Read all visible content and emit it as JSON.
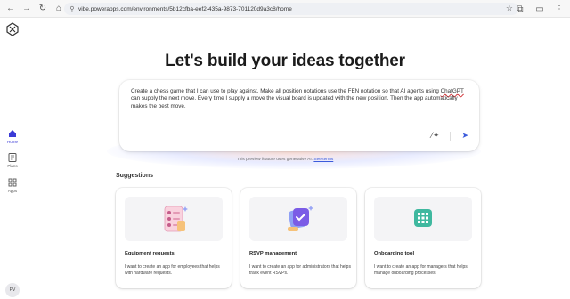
{
  "browser": {
    "url": "vibe.powerapps.com/environments/5b12cfba-eef2-435a-9873-701120d9a3c8/home",
    "nav": [
      "back-icon",
      "forward-icon",
      "refresh-icon",
      "home-icon"
    ]
  },
  "rail": {
    "items": [
      {
        "label": "Home",
        "icon": "home-icon",
        "active": true
      },
      {
        "label": "Plans",
        "icon": "plans-icon",
        "active": false
      },
      {
        "label": "Apps",
        "icon": "apps-icon",
        "active": false
      }
    ],
    "avatar": "PV"
  },
  "main": {
    "headline": "Let's build your ideas together",
    "prompt": {
      "text_before": "Create a chess game that I can use to play against. Make all position notations use the FEN notation so that AI agents using ",
      "text_spell": "ChatGPT",
      "text_after": " can supply the next move. Every time I supply a move the visual board is updated with the new position. Then the app automatically makes the best move."
    },
    "disclaimer": "This preview feature uses generative AI.",
    "disclaimer_link": "See terms",
    "suggestions_title": "Suggestions",
    "suggestions": [
      {
        "title": "Equipment requests",
        "desc": "I want to create an app for employees that helps with hardware requests."
      },
      {
        "title": "RSVP management",
        "desc": "I want to create an app for administrators that helps track event RSVPs."
      },
      {
        "title": "Onboarding tool",
        "desc": "I want to create an app for managers that helps manage onboarding processes."
      }
    ]
  },
  "colors": {
    "accent": "#3b5bdb",
    "active_nav": "#3b3bd6"
  }
}
